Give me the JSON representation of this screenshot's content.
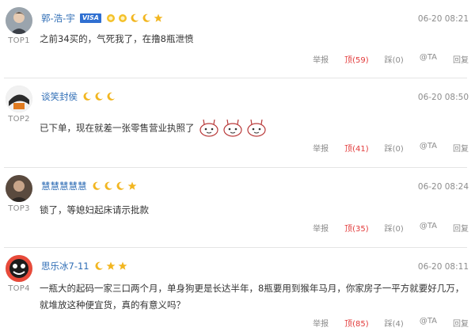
{
  "comments": [
    {
      "rank": "TOP1",
      "username": "郭-浩-宇",
      "badge": "VISA",
      "time": "06-20 08:21",
      "content_lines": [
        "之前34买的，气死我了，在撸8瓶泄愤"
      ],
      "actions": {
        "report": "举报",
        "up_label": "顶",
        "up_count": "(59)",
        "down_label": "踩",
        "down_count": "(0)",
        "at": "@TA",
        "reply": "回复"
      },
      "level_icons": [
        "sun-icon",
        "sun-icon",
        "moon-icon",
        "moon-icon",
        "star-icon"
      ]
    },
    {
      "rank": "TOP2",
      "username": "谈笑封侯",
      "time": "06-20 08:50",
      "content_lines": [
        "已下单，现在就差一张零售营业执照了"
      ],
      "actions": {
        "report": "举报",
        "up_label": "顶",
        "up_count": "(41)",
        "down_label": "踩",
        "down_count": "(0)",
        "at": "@TA",
        "reply": "回复"
      },
      "level_icons": [
        "moon-icon",
        "moon-icon",
        "moon-icon"
      ]
    },
    {
      "rank": "TOP3",
      "username": "慧慧慧慧慧",
      "time": "06-20 08:24",
      "content_lines": [
        "锁了，等媳妇起床请示批款"
      ],
      "actions": {
        "report": "举报",
        "up_label": "顶",
        "up_count": "(35)",
        "down_label": "踩",
        "down_count": "(0)",
        "at": "@TA",
        "reply": "回复"
      },
      "level_icons": [
        "moon-icon",
        "moon-icon",
        "moon-icon",
        "star-icon"
      ]
    },
    {
      "rank": "TOP4",
      "username": "思乐冰7-11",
      "time": "06-20 08:11",
      "content_lines": [
        "一瓶大的起码一家三口两个月，单身狗更是长达半年，8瓶要用到猴年马月，你家房子一平方就要好几万，",
        "就堆放这种便宜货，真的有意义吗？"
      ],
      "actions": {
        "report": "举报",
        "up_label": "顶",
        "up_count": "(85)",
        "down_label": "踩",
        "down_count": "(4)",
        "at": "@TA",
        "reply": "回复"
      },
      "level_icons": [
        "moon-icon",
        "star-icon",
        "star-icon"
      ]
    }
  ],
  "colors": {
    "username": "#2f6db5",
    "up": "#e23a3a",
    "muted": "#8c8c8c",
    "moon": "#f2b620",
    "star": "#f2b620"
  }
}
